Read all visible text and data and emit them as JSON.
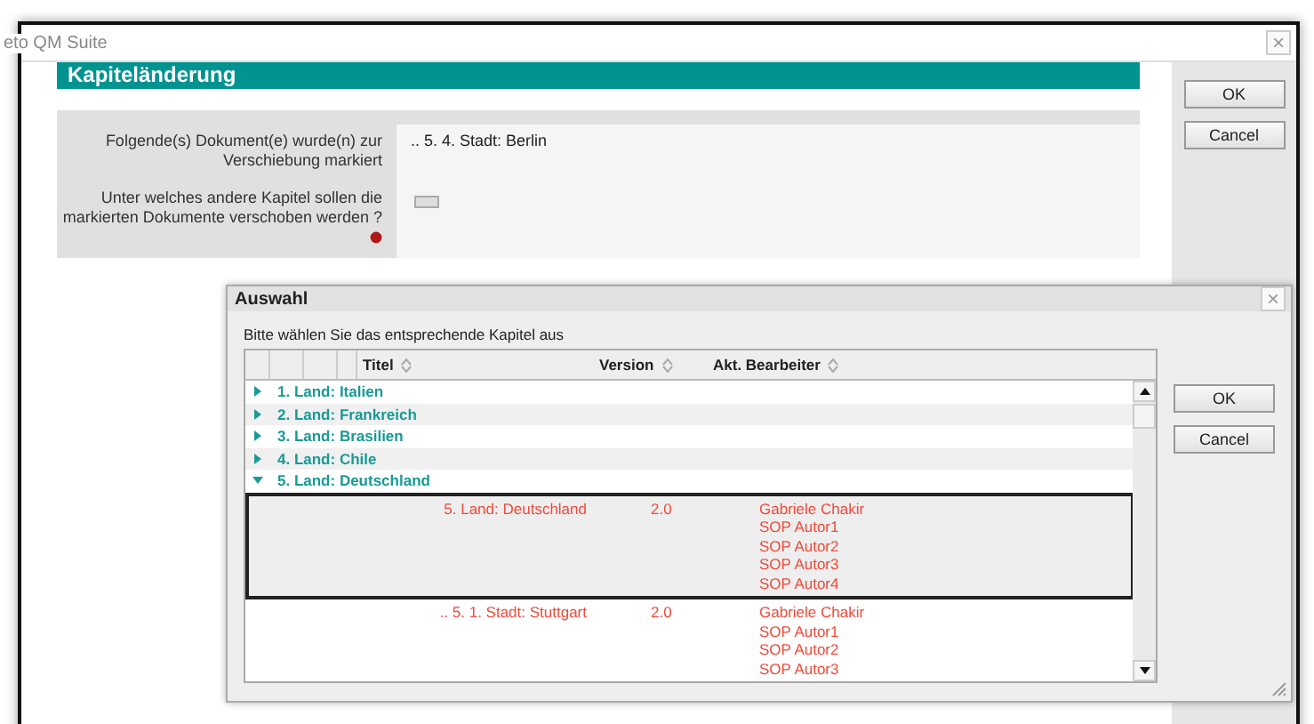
{
  "window": {
    "title": "eto QM Suite",
    "close": "×"
  },
  "header": "Kapiteländerung",
  "form": {
    "rows": [
      {
        "kind": "text",
        "label": "Folgende(s) Dokument(e) wurde(n) zur Verschiebung markiert",
        "value": "..  5.  4. Stadt: Berlin"
      },
      {
        "kind": "picker",
        "label": "Unter welches andere Kapitel sollen die markierten Dokumente verschoben werden ?",
        "required": true
      }
    ]
  },
  "buttons": [
    "OK",
    "Cancel"
  ],
  "dialog": {
    "title": "Auswahl",
    "close": "×",
    "instruction": "Bitte wählen Sie das entsprechende Kapitel aus",
    "columns": [
      "Titel",
      "Version",
      "Akt. Bearbeiter"
    ],
    "chapters": [
      {
        "title": "1. Land: Italien",
        "expanded": false
      },
      {
        "title": "2. Land: Frankreich",
        "expanded": false
      },
      {
        "title": "3. Land: Brasilien",
        "expanded": false
      },
      {
        "title": "4. Land: Chile",
        "expanded": false
      },
      {
        "title": "5. Land: Deutschland",
        "expanded": true,
        "children": [
          {
            "title": "5. Land: Deutschland",
            "version": "2.0",
            "editors": [
              "Gabriele Chakir",
              "SOP Autor1",
              "SOP Autor2",
              "SOP Autor3",
              "SOP Autor4"
            ],
            "selected": true
          },
          {
            "title": "..  5.  1. Stadt: Stuttgart",
            "version": "2.0",
            "editors": [
              "Gabriele Chakir",
              "SOP Autor1",
              "SOP Autor2",
              "SOP Autor3"
            ],
            "selected": false
          }
        ]
      }
    ],
    "buttons": [
      "OK",
      "Cancel"
    ]
  }
}
